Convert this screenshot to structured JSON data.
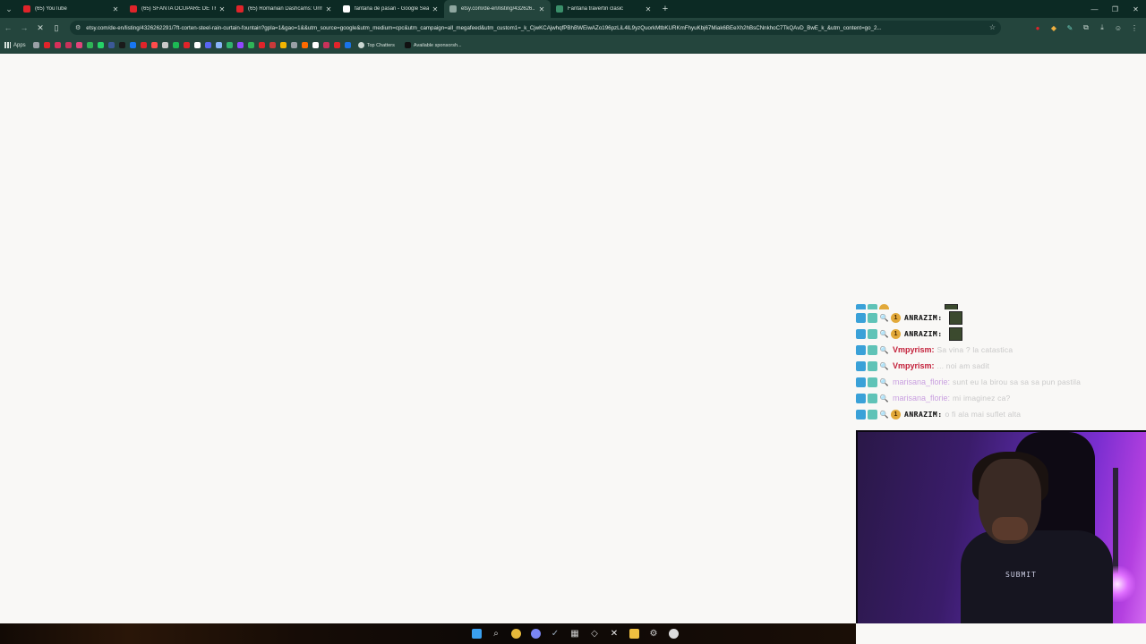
{
  "tabs": [
    {
      "title": "(65) YouTube",
      "favicon_color": "#e0242a",
      "active": false
    },
    {
      "title": "(65) SFÂNTA OCUPARE DE TRO",
      "favicon_color": "#e0242a",
      "active": false
    },
    {
      "title": "(65) Romanian Dashcams: Urm...",
      "favicon_color": "#e0242a",
      "active": false
    },
    {
      "title": "fantana de pasari - Google Sea...",
      "favicon_color": "#ffffff",
      "active": false
    },
    {
      "title": "etsy.com/de-en/listing/432626...",
      "favicon_color": "#8fa7a0",
      "active": true
    },
    {
      "title": "Fantana travertin clasic",
      "favicon_color": "#3a8f6a",
      "active": false
    }
  ],
  "address_bar": {
    "url": "etsy.com/de-en/listing/4326262291/7ft-corten-steel-rain-curtain-fountain?gpla=1&gao=1&&utm_source=google&utm_medium=cpc&utm_campaign=all_megafeed&utm_custom1=_k_CjwKCAjwhqfPBhBWEiwAZo196pzLiL4lL9yzQuorkMtbKURKmFhyuKbj67Miak6BEeXh2hBsCNnkhoC7TkQAvD_BwE_k_&utm_content=go_2..."
  },
  "bookmarks": {
    "apps_label": "Apps",
    "icon_colors": [
      "#e0242a",
      "#d6305a",
      "#c8325a",
      "#e0447a",
      "#2fb457",
      "#25d366",
      "#3b5998",
      "#1a1a1a",
      "#1877f2",
      "#e0242a",
      "#ff4c4c",
      "#c9c9c9",
      "#1db954",
      "#e0242a",
      "#ffffff",
      "#5865f2",
      "#8ab4f8",
      "#30b36b",
      "#9146ff",
      "#2fb457",
      "#e0242a",
      "#c83a3a",
      "#f4b400",
      "#9aa0a6",
      "#ff6a00",
      "#ffffff",
      "#c8325a",
      "#e0242a",
      "#1a73e8"
    ],
    "top_chatters_label": "Top Chatters",
    "available_label": "Available sponsorsh..."
  },
  "chat": {
    "messages": [
      {
        "user": "ANRAZIM:",
        "user_style": "blur",
        "badges": [
          "blue",
          "teal",
          "mag",
          "gold"
        ],
        "text": "",
        "emote": true
      },
      {
        "user": "ANRAZIM:",
        "user_style": "blur",
        "badges": [
          "blue",
          "teal",
          "mag",
          "gold"
        ],
        "text": "",
        "emote": true
      },
      {
        "user": "Vmpyrism:",
        "user_style": "red",
        "badges": [
          "blue",
          "teal",
          "mag"
        ],
        "text": "Sa vina ? la catastica"
      },
      {
        "user": "Vmpyrism:",
        "user_style": "red",
        "badges": [
          "blue",
          "teal",
          "mag"
        ],
        "text": "... noi am sadit"
      },
      {
        "user": "marisana_florie:",
        "user_style": "purple",
        "badges": [
          "blue",
          "teal",
          "mag"
        ],
        "text": "sunt eu la birou sa sa sa pun pastila"
      },
      {
        "user": "marisana_florie:",
        "user_style": "purple",
        "badges": [
          "blue",
          "teal",
          "mag"
        ],
        "text": "mi imaginez ca?"
      },
      {
        "user": "ANRAZIM:",
        "user_style": "blur",
        "badges": [
          "blue",
          "teal",
          "mag",
          "gold"
        ],
        "text": "o fi ala mai suflet alta"
      }
    ],
    "gold_badge_text": "1"
  },
  "webcam": {
    "shirt_print": "SUBMIT"
  },
  "colors": {
    "tabstrip": "#0c2a24",
    "toolbar": "#24453d",
    "page_bg": "#f9f8f6",
    "username_red": "#c3213b"
  }
}
